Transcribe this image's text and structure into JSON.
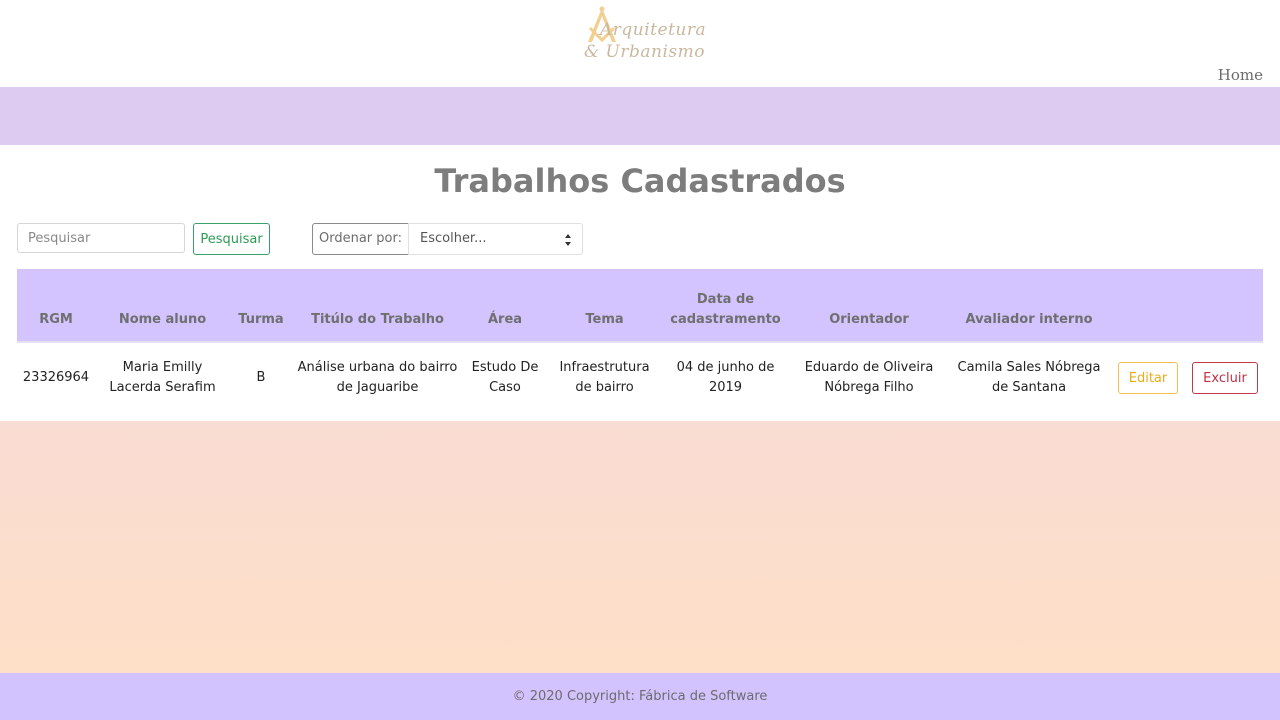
{
  "header": {
    "logo": {
      "line1": "Arquitetura",
      "line2": "& Urbanismo",
      "icon": "compass-square-icon"
    },
    "nav": {
      "home_label": "Home"
    }
  },
  "colors": {
    "banner": "#decbf2",
    "table_header": "#d3c3ff",
    "footer": "#d2c3ff",
    "gradient_top": "#f9dcd3",
    "gradient_bottom": "#fedfc7",
    "title": "#7d7d7d",
    "search_button": "#38a169",
    "edit_button": "#f2c24a",
    "delete_button": "#c0394b"
  },
  "main": {
    "title": "Trabalhos Cadastrados",
    "search": {
      "placeholder": "Pesquisar",
      "value": "",
      "button_label": "Pesquisar"
    },
    "order": {
      "label": "Ordenar por:",
      "selected": "Escolher..."
    },
    "table": {
      "columns": [
        "RGM",
        "Nome aluno",
        "Turma",
        "Titúlo do Trabalho",
        "Área",
        "Tema",
        "Data de cadastramento",
        "Orientador",
        "Avaliador interno"
      ],
      "rows": [
        {
          "rgm": "23326964",
          "nome": "Maria Emilly Lacerda Serafim",
          "turma": "B",
          "titulo": "Análise urbana do bairro de Jaguaribe",
          "area": "Estudo De Caso",
          "tema": "Infraestrutura de bairro",
          "data": "04 de junho de 2019",
          "orientador": "Eduardo de Oliveira Nóbrega Filho",
          "avaliador": "Camila Sales Nóbrega de Santana",
          "edit_label": "Editar",
          "delete_label": "Excluir"
        }
      ]
    }
  },
  "footer": {
    "text": "© 2020 Copyright: Fábrica de Software"
  }
}
